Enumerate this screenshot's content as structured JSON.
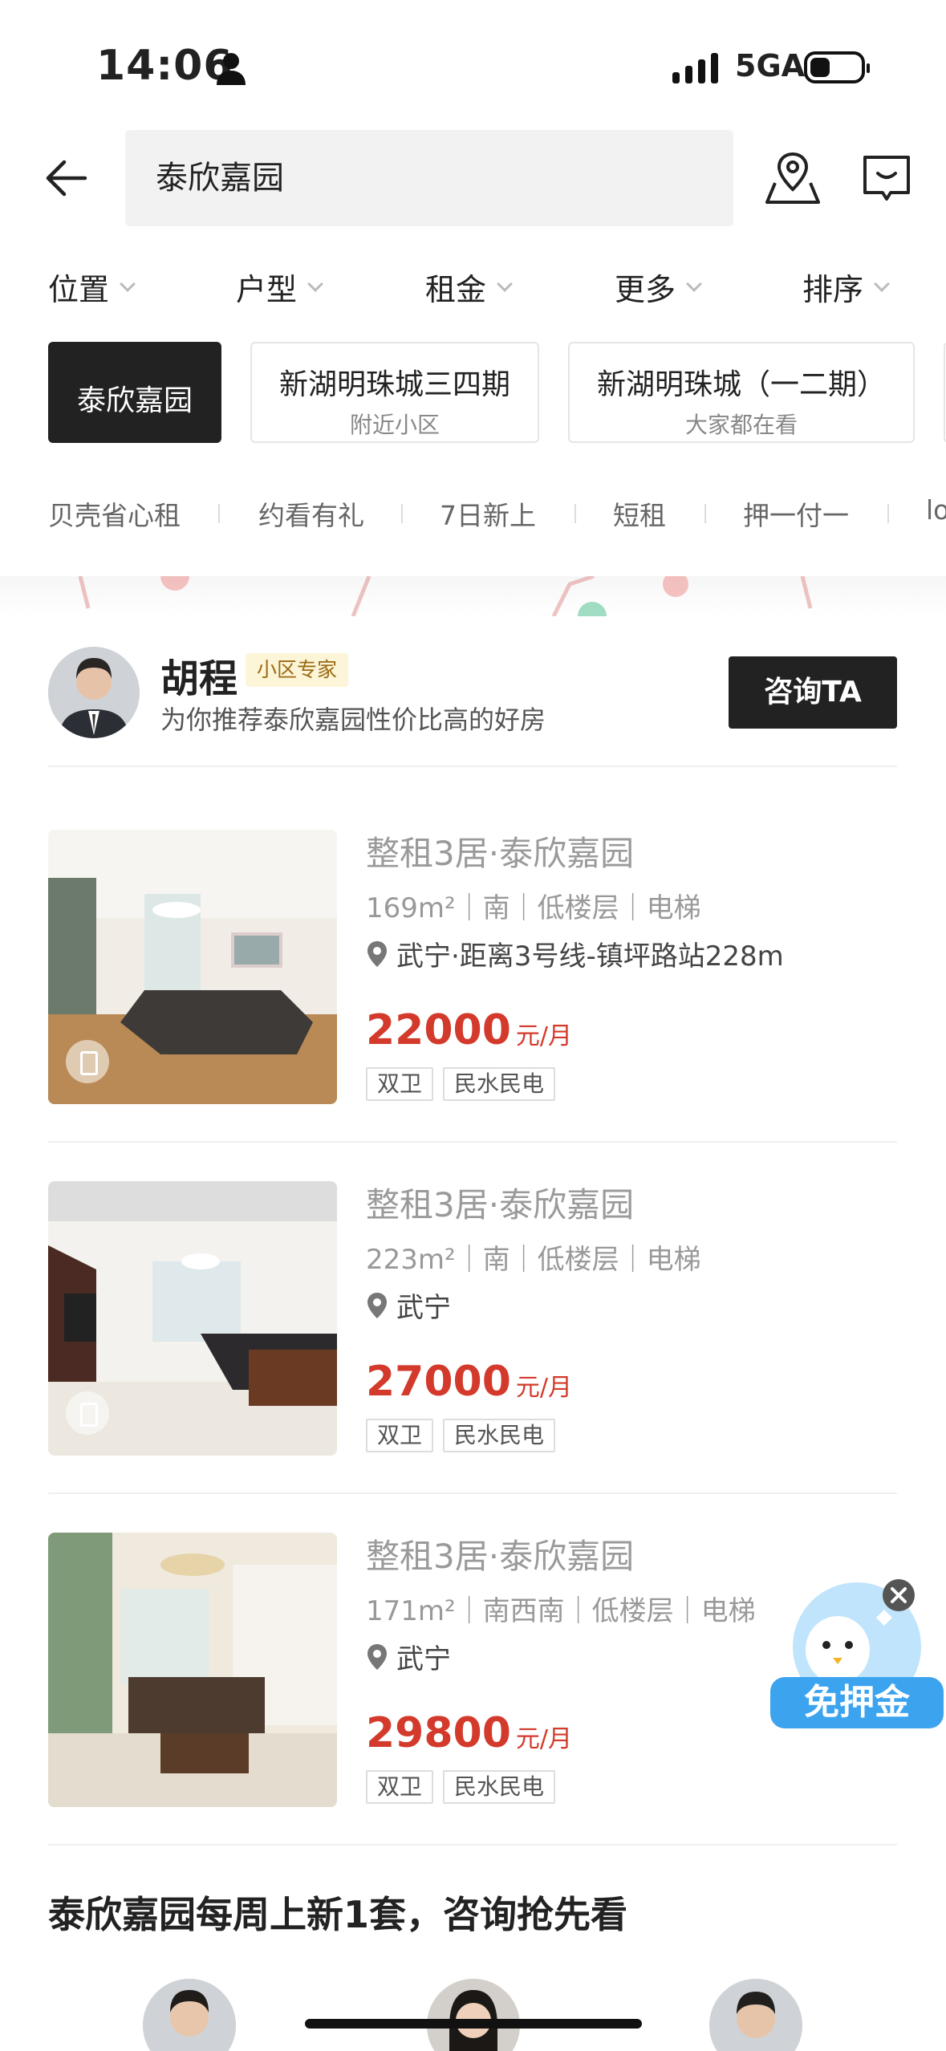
{
  "status_bar": {
    "time": "14:06",
    "network": "5GA"
  },
  "search": {
    "value": "泰欣嘉园"
  },
  "filters": [
    "位置",
    "户型",
    "租金",
    "更多",
    "排序"
  ],
  "chips": [
    {
      "title": "泰欣嘉园",
      "subtitle": ""
    },
    {
      "title": "新湖明珠城三四期",
      "subtitle": "附近小区"
    },
    {
      "title": "新湖明珠城（一二期）",
      "subtitle": "大家都在看"
    }
  ],
  "quick_tags": [
    "贝壳省心租",
    "约看有礼",
    "7日新上",
    "短租",
    "押一付一",
    "lo"
  ],
  "agent": {
    "name": "胡程",
    "badge": "小区专家",
    "subtitle": "为你推荐泰欣嘉园性价比高的好房",
    "button": "咨询TA"
  },
  "listings": [
    {
      "title": "整租3居·泰欣嘉园",
      "meta": "169m²｜南｜低楼层｜电梯",
      "location": "武宁·距离3号线-镇坪路站228m",
      "price": "22000",
      "unit": "元/月",
      "tags": [
        "双卫",
        "民水民电"
      ]
    },
    {
      "title": "整租3居·泰欣嘉园",
      "meta": "223m²｜南｜低楼层｜电梯",
      "location": "武宁",
      "price": "27000",
      "unit": "元/月",
      "tags": [
        "双卫",
        "民水民电"
      ]
    },
    {
      "title": "整租3居·泰欣嘉园",
      "meta": "171m²｜南西南｜低楼层｜电梯",
      "location": "武宁",
      "price": "29800",
      "unit": "元/月",
      "tags": [
        "双卫",
        "民水民电"
      ]
    }
  ],
  "promo": {
    "label": "免押金"
  },
  "weekly": {
    "text": "泰欣嘉园每周上新1套，咨询抢先看"
  },
  "colors": {
    "price": "#d33a2c",
    "dark": "#222222",
    "badge_bg": "#fdf5d8",
    "promo_blue": "#3ca3ef"
  }
}
